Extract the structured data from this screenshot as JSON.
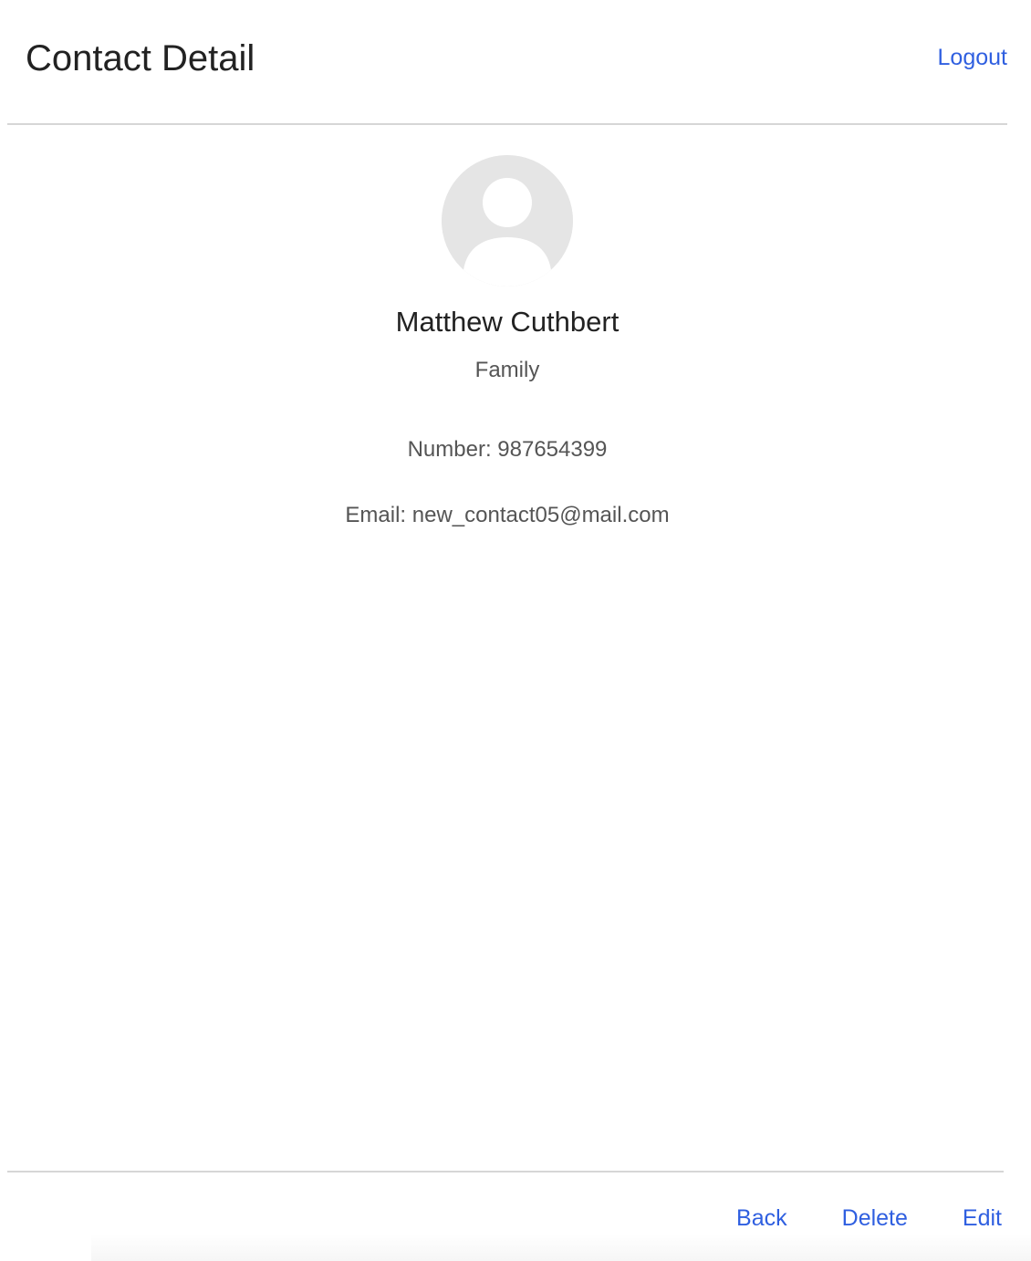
{
  "header": {
    "title": "Contact Detail",
    "logout_label": "Logout"
  },
  "contact": {
    "avatar_icon": "default-person-icon",
    "name": "Matthew Cuthbert",
    "group": "Family",
    "number_line": "Number: 987654399",
    "email_line": "Email: new_contact05@mail.com"
  },
  "footer": {
    "back_label": "Back",
    "delete_label": "Delete",
    "edit_label": "Edit"
  },
  "colors": {
    "link": "#2f5fe0",
    "title_text": "#222222",
    "secondary_text": "#555555",
    "avatar_bg": "#e5e5e5",
    "divider": "#d6d6d6"
  }
}
